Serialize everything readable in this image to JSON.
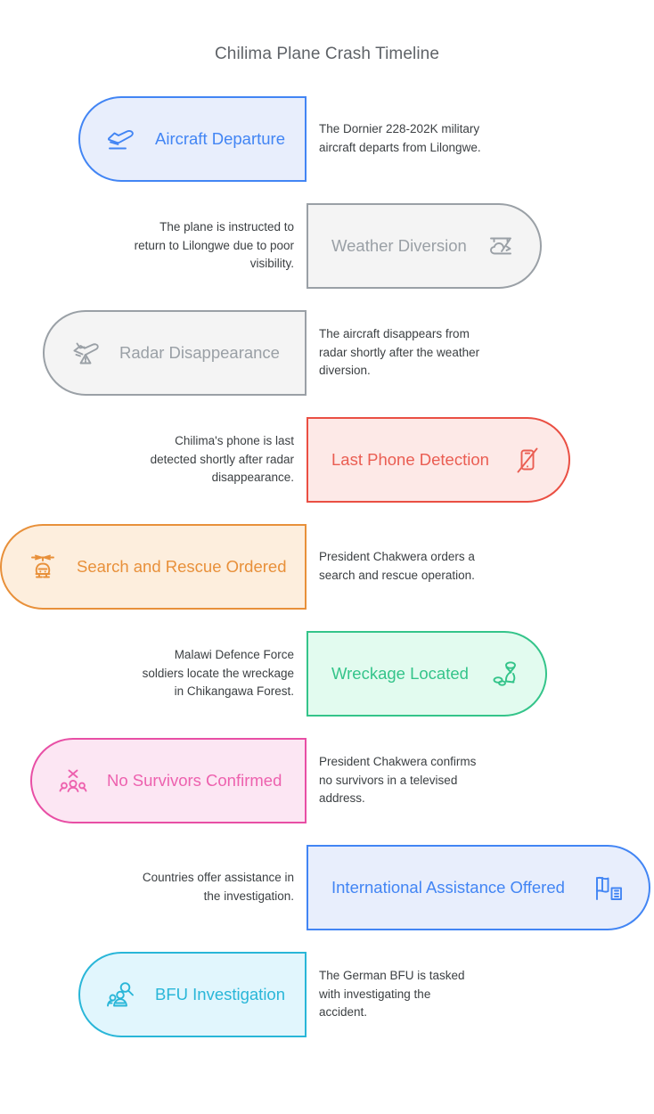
{
  "title": "Chilima Plane Crash Timeline",
  "timeline": {
    "items": [
      {
        "label": "Aircraft Departure",
        "description": "The Dornier 228-202K military aircraft departs from Lilongwe.",
        "icon": "airplane-takeoff-icon",
        "side": "left",
        "fill": "#e8eefc",
        "stroke": "#4285f4",
        "text": "#4285f4",
        "pill_width": 256
      },
      {
        "label": "Weather Diversion",
        "description": "The plane is instructed to return to Lilongwe due to poor visibility.",
        "icon": "cloud-weather-icon",
        "side": "right",
        "fill": "#f4f4f4",
        "stroke": "#9aa0a6",
        "text": "#9aa0a6",
        "pill_width": 264
      },
      {
        "label": "Radar Disappearance",
        "description": "The aircraft disappears from radar shortly after the weather diversion.",
        "icon": "plane-crash-warning-icon",
        "side": "left",
        "fill": "#f4f4f4",
        "stroke": "#9aa0a6",
        "text": "#9aa0a6",
        "pill_width": 296
      },
      {
        "label": "Last Phone Detection",
        "description": "Chilima's phone is last detected shortly after radar disappearance.",
        "icon": "phone-off-icon",
        "side": "right",
        "fill": "#fde9e7",
        "stroke": "#ea4f43",
        "text": "#ea5d52",
        "pill_width": 296
      },
      {
        "label": "Search and Rescue Ordered",
        "description": "President Chakwera orders a search and rescue operation.",
        "icon": "helicopter-icon",
        "side": "left",
        "fill": "#fdeedd",
        "stroke": "#e8903a",
        "text": "#e8903a",
        "pill_width": 344
      },
      {
        "label": "Wreckage Located",
        "description": "Malawi Defence Force soldiers locate the wreckage in Chikangawa Forest.",
        "icon": "wreckage-debris-icon",
        "side": "right",
        "fill": "#e2fbef",
        "stroke": "#34c48a",
        "text": "#34c48a",
        "pill_width": 270
      },
      {
        "label": "No Survivors Confirmed",
        "description": "President Chakwera confirms no survivors in a televised address.",
        "icon": "people-no-survivors-icon",
        "side": "left",
        "fill": "#fce6f3",
        "stroke": "#e84fa5",
        "text": "#ed61ae",
        "pill_width": 310
      },
      {
        "label": "International Assistance Offered",
        "description": "Countries offer assistance in the investigation.",
        "icon": "map-flag-icon",
        "side": "right",
        "fill": "#e8eefc",
        "stroke": "#4285f4",
        "text": "#4285f4",
        "pill_width": 386
      },
      {
        "label": "BFU Investigation",
        "description": "The German BFU is tasked with investigating the accident.",
        "icon": "investigators-search-icon",
        "side": "left",
        "fill": "#e1f6fd",
        "stroke": "#29b6d8",
        "text": "#29b6d8",
        "pill_width": 256
      }
    ]
  }
}
